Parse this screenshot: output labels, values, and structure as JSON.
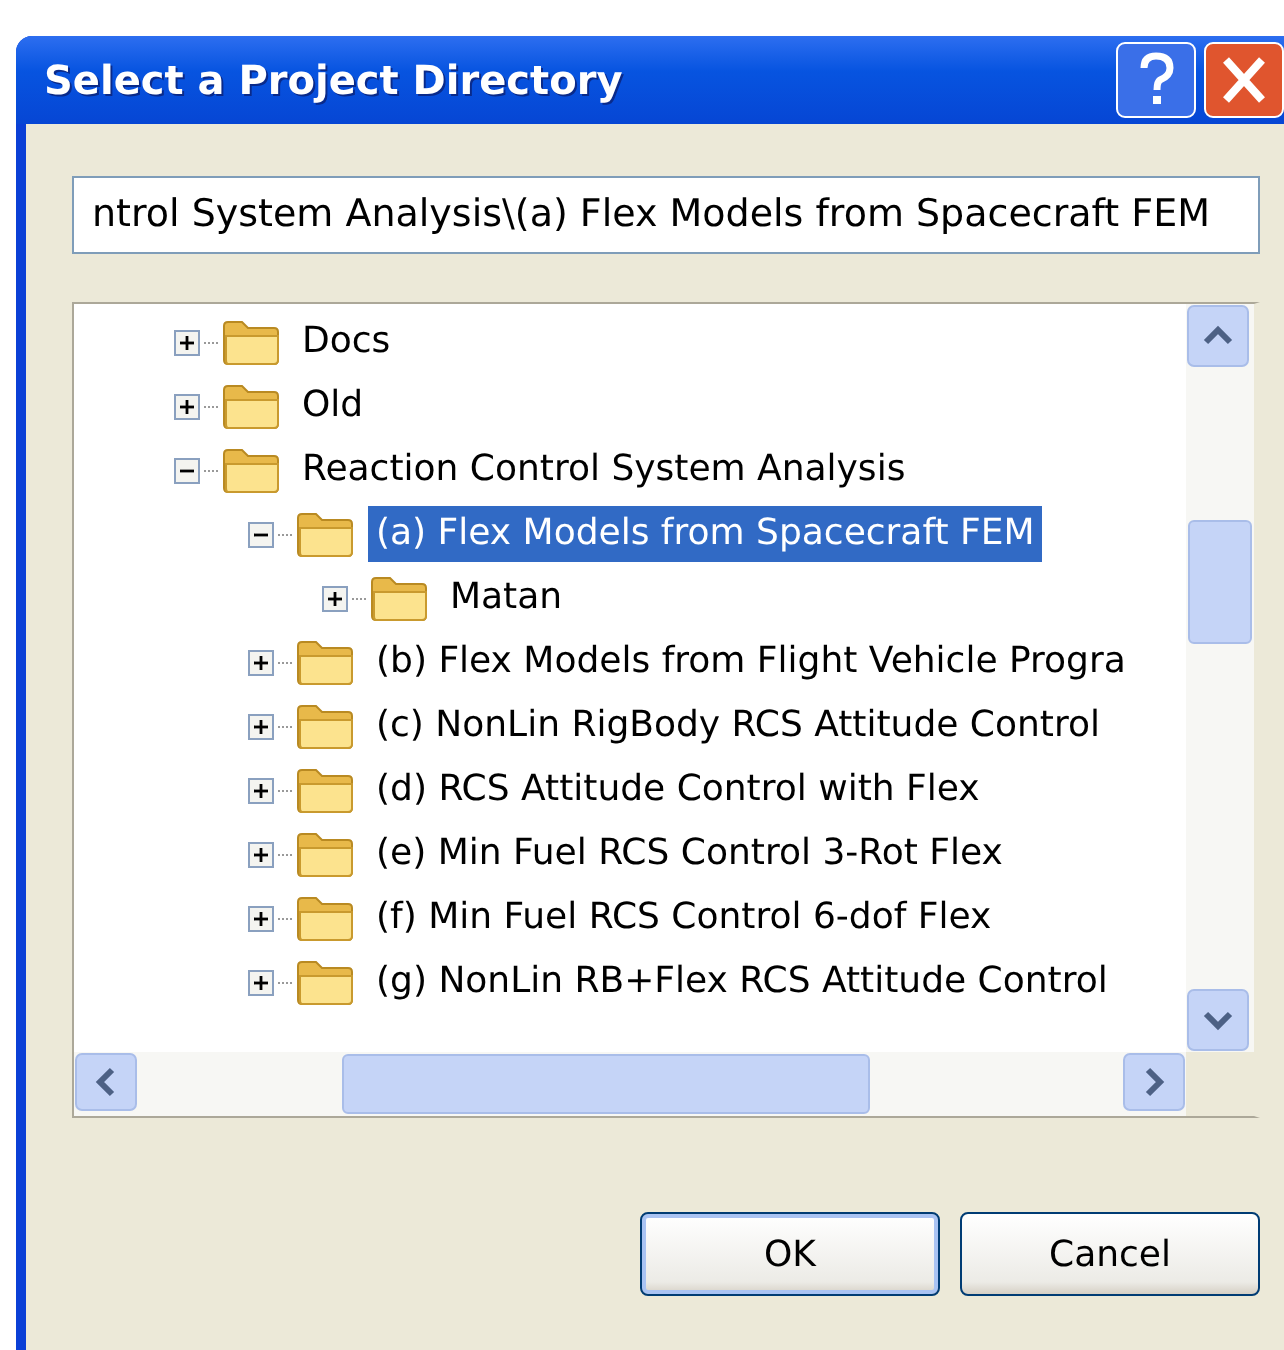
{
  "window": {
    "title": "Select a Project Directory"
  },
  "path_field": {
    "value": "ntrol System Analysis\\(a) Flex Models from Spacecraft FEM"
  },
  "tree": [
    {
      "label": "Docs",
      "expanded": false,
      "selected": false
    },
    {
      "label": "Old",
      "expanded": false,
      "selected": false
    },
    {
      "label": "Reaction Control System Analysis",
      "expanded": true,
      "selected": false,
      "children": [
        {
          "label": "(a) Flex Models from Spacecraft FEM",
          "expanded": true,
          "selected": true,
          "children": [
            {
              "label": "Matan",
              "expanded": false,
              "selected": false
            }
          ]
        },
        {
          "label": "(b) Flex Models from Flight Vehicle Progra",
          "expanded": false,
          "selected": false
        },
        {
          "label": "(c) NonLin RigBody RCS Attitude Control",
          "expanded": false,
          "selected": false
        },
        {
          "label": "(d) RCS Attitude Control with Flex",
          "expanded": false,
          "selected": false
        },
        {
          "label": "(e) Min Fuel RCS Control 3-Rot Flex",
          "expanded": false,
          "selected": false
        },
        {
          "label": "(f) Min Fuel RCS Control 6-dof Flex",
          "expanded": false,
          "selected": false
        },
        {
          "label": "(g) NonLin RB+Flex RCS Attitude Control",
          "expanded": false,
          "selected": false
        }
      ]
    }
  ],
  "buttons": [
    {
      "label": "OK",
      "default": true
    },
    {
      "label": "Cancel",
      "default": false
    }
  ]
}
